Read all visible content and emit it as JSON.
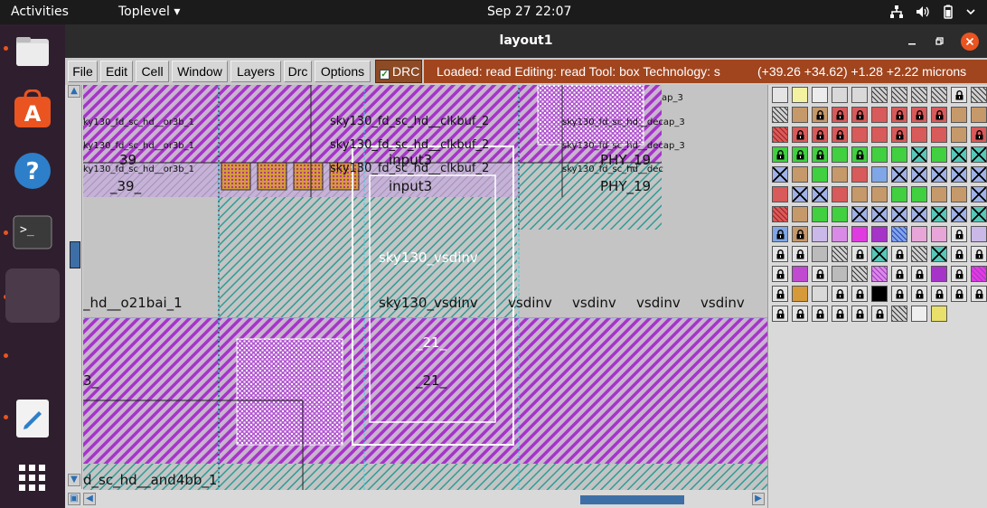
{
  "topbar": {
    "activities": "Activities",
    "app_menu": "Toplevel ▾",
    "clock": "Sep 27  22:07"
  },
  "window": {
    "title": "layout1"
  },
  "menu": {
    "items": [
      "File",
      "Edit",
      "Cell",
      "Window",
      "Layers",
      "Drc",
      "Options"
    ],
    "drc_label": "DRC",
    "status": "Loaded: read Editing: read Tool: box  Technology: s",
    "coords": "(+39.26 +34.62) +1.28 +2.22 microns"
  },
  "canvas": {
    "labels": {
      "or3b_top": "ky130_fd_sc_hd__or3b_1",
      "or3b_mid": "ky130_fd_sc_hd__or3b_1",
      "or3b_low": "ky130_fd_sc_hd__or3b_1",
      "n39_a": "39",
      "n39_b": "_39_",
      "clkbuf_1": "sky130_fd_sc_hd__clkbuf_2",
      "clkbuf_2": "sky130_fd_sc_hd__clkbuf_2",
      "clkbuf_3": "sky130_fd_sc_hd__clkbuf_2",
      "input3_a": "input3",
      "input3_b": "input3",
      "decap_1": "ap_3",
      "decap_2": "sky130_fd_sc_hd__decap_3",
      "decap_3": "sky130_fd_sc_hd__decap_3",
      "decap_4": "sky130_fd_sc_hd__dec",
      "phy_a": "PHY_19",
      "phy_b": "PHY_19",
      "vsdinv_white": "sky130_vsdinv",
      "vsdinv_main": "sky130_vsdinv",
      "vsdinv_2": "vsdinv",
      "vsdinv_3": "vsdinv",
      "vsdinv_4": "vsdinv",
      "vsdinv_5": "vsdinv",
      "o21bai": "_hd__o21bai_1",
      "n21_white": "_21_",
      "n21_main": "_21_",
      "n3": "3_",
      "and4bb": "d_sc_hd__and4bb_1"
    }
  },
  "palette": {
    "rows": 13,
    "cols": 11,
    "layers": [
      [
        "grid",
        "yellow-outline",
        "grey-outline",
        "grey",
        "grey",
        "hatch-black",
        "hatch-black",
        "hatch-grey",
        "hatch-grey",
        "lock",
        "hatch-grey"
      ],
      [
        "hatch-black",
        "tan",
        "lock-tan",
        "lock-red",
        "lock-red",
        "red",
        "lock-red",
        "lock-red",
        "lock-red",
        "tan",
        "tan"
      ],
      [
        "red-hatch",
        "lock-red",
        "lock-red",
        "lock-red",
        "red",
        "red",
        "lock-red",
        "red",
        "red",
        "tan",
        "lock-red"
      ],
      [
        "lock-green",
        "lock-green",
        "lock-green",
        "green",
        "lock-green",
        "green",
        "green",
        "cross-teal",
        "green",
        "cross-teal",
        "cross-teal"
      ],
      [
        "cross-navy",
        "tan-dots",
        "green-dots",
        "tan-dots",
        "red-dots",
        "blue",
        "cross-blue",
        "cross-blue",
        "cross-blue",
        "cross-blue",
        "cross-blue"
      ],
      [
        "red",
        "cross-violet",
        "cross-navy",
        "red",
        "tan",
        "tan",
        "green",
        "green",
        "tan",
        "tan",
        "cross-navy"
      ],
      [
        "red-hatch",
        "tan",
        "green",
        "green",
        "cross-navy",
        "cross-navy",
        "cross-navy",
        "cross-navy",
        "cross-teal",
        "cross-navy",
        "cross-teal"
      ],
      [
        "lock-blue",
        "lock-tan",
        "lavender",
        "violet",
        "magenta",
        "purple-dots",
        "blue-hatch",
        "pink-dots",
        "pink-dots",
        "lock",
        "lavender"
      ],
      [
        "lock",
        "lock",
        "grey-dots",
        "grey-hatch",
        "lock",
        "cross-teal",
        "lock",
        "hatch-grey",
        "cross-teal",
        "lock",
        "lock"
      ],
      [
        "lock",
        "magenta-dots",
        "lock",
        "grey-dots",
        "hatch-grey",
        "violet-hatch",
        "lock",
        "lock",
        "purple-dots",
        "lock",
        "magenta-hatch"
      ],
      [
        "lock",
        "orange-dots",
        "grey-waves",
        "lock",
        "lock",
        "black",
        "lock",
        "lock",
        "lock",
        "lock",
        "lock"
      ],
      [
        "lock",
        "lock",
        "lock",
        "lock",
        "lock",
        "lock",
        "hatch-black",
        "white-dots",
        "yellow",
        "",
        ""
      ],
      [
        "",
        "",
        "",
        "",
        "",
        "",
        "",
        "",
        "",
        "",
        ""
      ]
    ]
  }
}
